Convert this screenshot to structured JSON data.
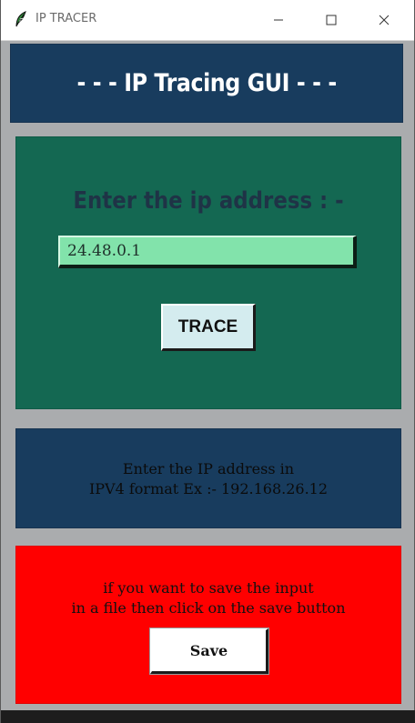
{
  "window": {
    "title": "IP TRACER",
    "icon": "feather-logo-icon",
    "controls": [
      "minimize-icon",
      "maximize-icon",
      "close-icon"
    ]
  },
  "header": {
    "title": "- - - IP Tracing GUI - - -"
  },
  "input_section": {
    "label": "Enter the ip address : -",
    "ip_value": "24.48.0.1",
    "trace_button": "TRACE"
  },
  "info_section": {
    "line1": "Enter the IP address in",
    "line2": "IPV4 format Ex :- 192.168.26.12"
  },
  "save_section": {
    "line1": "if you want to save the input",
    "line2": "in a file then click on the save button",
    "save_button": "Save"
  },
  "colors": {
    "header_bg": "#183c5e",
    "input_panel_bg": "#146852",
    "entry_bg": "#82e3ab",
    "save_panel_bg": "#ff0000",
    "window_bg": "#aaacae"
  }
}
